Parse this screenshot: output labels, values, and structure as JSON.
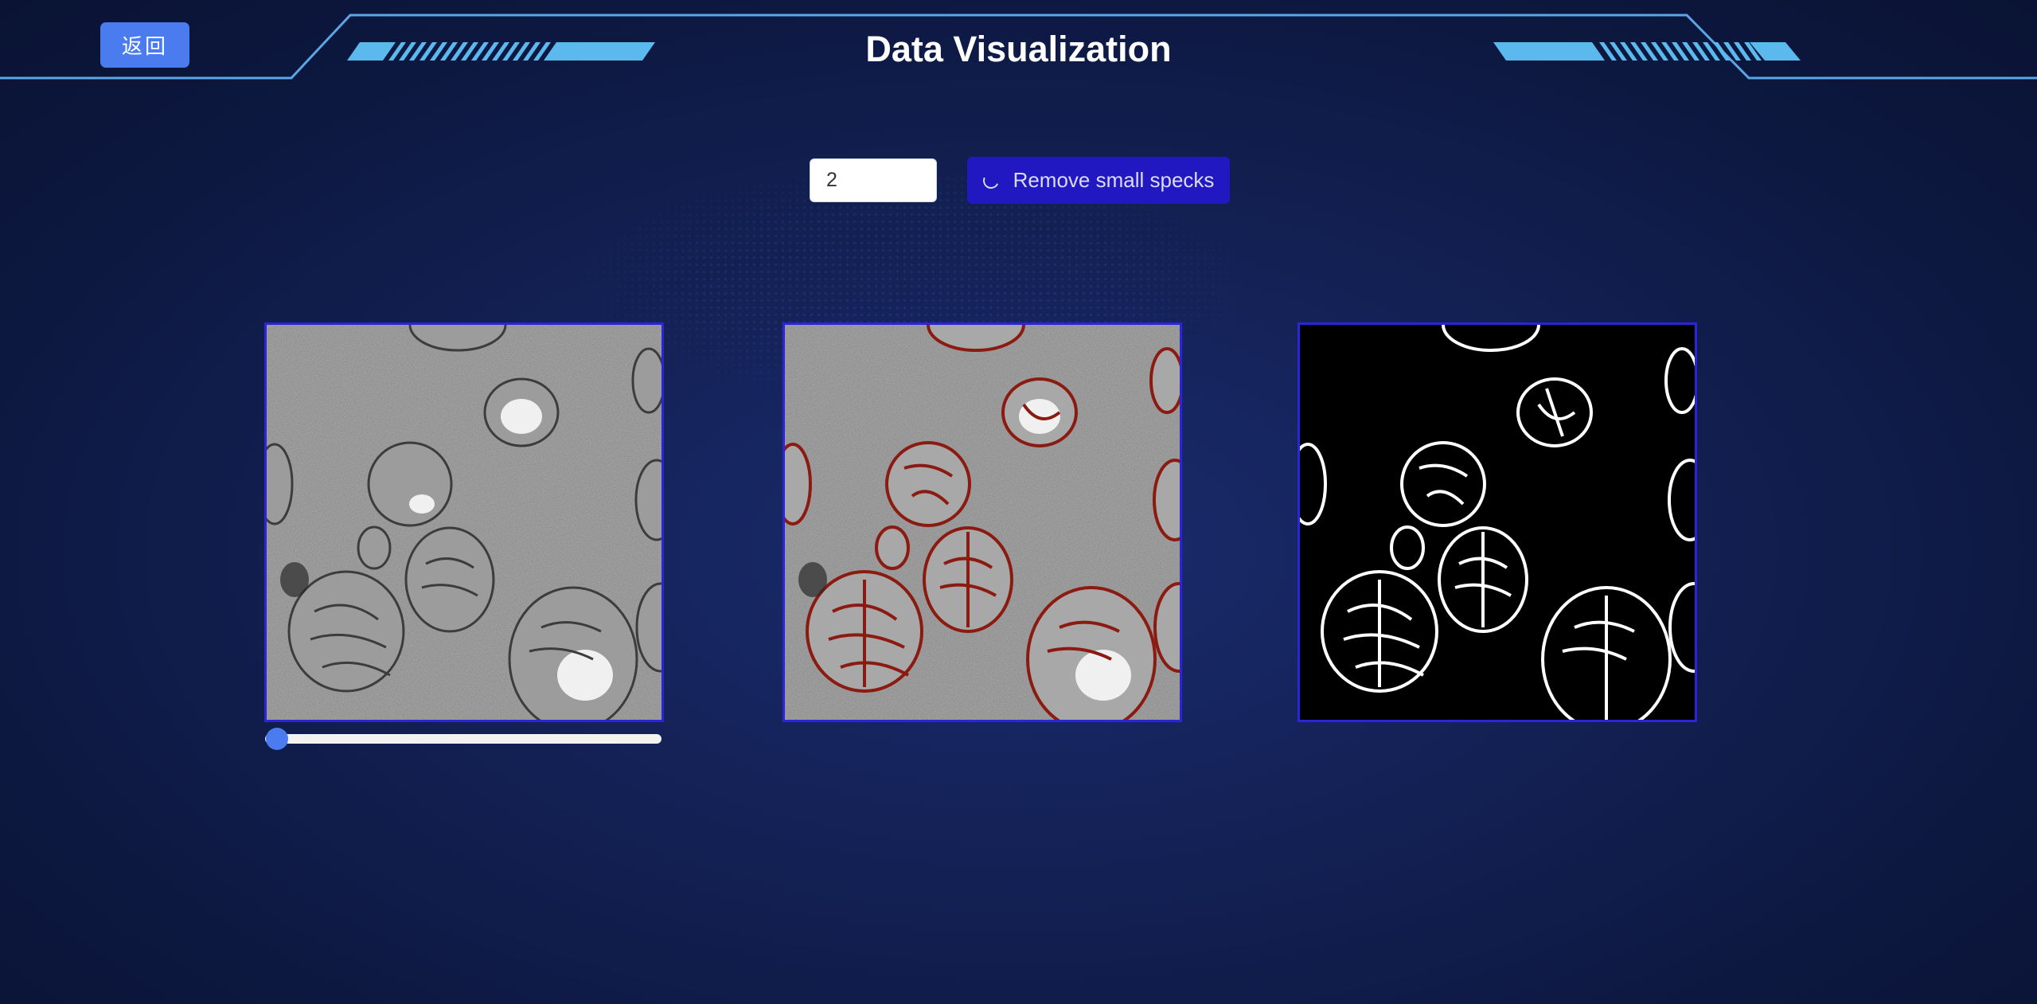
{
  "header": {
    "title": "Data Visualization",
    "back_label": "返回"
  },
  "controls": {
    "threshold_value": "2",
    "remove_button_label": "Remove small specks",
    "remove_button_state": "loading"
  },
  "panels": [
    {
      "name": "original-image",
      "content": "grayscale electron micrograph"
    },
    {
      "name": "overlay-image",
      "content": "micrograph with red segmentation contours"
    },
    {
      "name": "mask-image",
      "content": "binary white-on-black segmentation mask"
    }
  ],
  "slider": {
    "value": 0
  },
  "colors": {
    "background": "#0d1840",
    "accent": "#4a7cf0",
    "button": "#2218c2",
    "panel_border": "#2c24d8",
    "overlay_contour": "#8b1a10",
    "header_line": "#5aa6e6"
  },
  "icons": [
    "loading-spinner-icon"
  ]
}
